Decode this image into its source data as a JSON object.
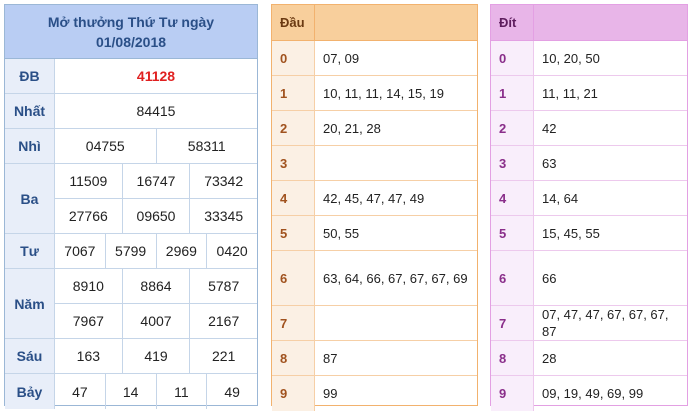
{
  "results": {
    "title_line1": "Mở thưởng Thứ Tư ngày",
    "title_line2": "01/08/2018",
    "rows": [
      {
        "label": "ĐB",
        "lines": [
          [
            "41128"
          ]
        ]
      },
      {
        "label": "Nhất",
        "lines": [
          [
            "84415"
          ]
        ]
      },
      {
        "label": "Nhì",
        "lines": [
          [
            "04755",
            "58311"
          ]
        ]
      },
      {
        "label": "Ba",
        "lines": [
          [
            "11509",
            "16747",
            "73342"
          ],
          [
            "27766",
            "09650",
            "33345"
          ]
        ]
      },
      {
        "label": "Tư",
        "lines": [
          [
            "7067",
            "5799",
            "2969",
            "0420"
          ]
        ]
      },
      {
        "label": "Năm",
        "lines": [
          [
            "8910",
            "8864",
            "5787"
          ],
          [
            "7967",
            "4007",
            "2167"
          ]
        ]
      },
      {
        "label": "Sáu",
        "lines": [
          [
            "163",
            "419",
            "221"
          ]
        ]
      },
      {
        "label": "Bảy",
        "lines": [
          [
            "47",
            "14",
            "11",
            "49"
          ]
        ]
      }
    ]
  },
  "dau": {
    "header": "Đầu",
    "rows": [
      {
        "key": "0",
        "value": "07, 09"
      },
      {
        "key": "1",
        "value": "10, 11, 11, 14, 15, 19"
      },
      {
        "key": "2",
        "value": "20, 21, 28"
      },
      {
        "key": "3",
        "value": ""
      },
      {
        "key": "4",
        "value": "42, 45, 47, 47, 49"
      },
      {
        "key": "5",
        "value": "50, 55"
      },
      {
        "key": "6",
        "value": "63, 64, 66, 67, 67, 67, 69"
      },
      {
        "key": "7",
        "value": ""
      },
      {
        "key": "8",
        "value": "87"
      },
      {
        "key": "9",
        "value": "99"
      }
    ]
  },
  "dit": {
    "header": "Đít",
    "rows": [
      {
        "key": "0",
        "value": "10, 20, 50"
      },
      {
        "key": "1",
        "value": "11, 11, 21"
      },
      {
        "key": "2",
        "value": "42"
      },
      {
        "key": "3",
        "value": "63"
      },
      {
        "key": "4",
        "value": "14, 64"
      },
      {
        "key": "5",
        "value": "15, 45, 55"
      },
      {
        "key": "6",
        "value": "66"
      },
      {
        "key": "7",
        "value": "07, 47, 47, 67, 67, 67, 87"
      },
      {
        "key": "8",
        "value": "28"
      },
      {
        "key": "9",
        "value": "09, 19, 49, 69, 99"
      }
    ]
  }
}
